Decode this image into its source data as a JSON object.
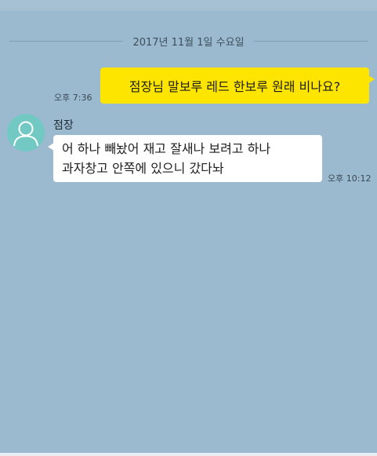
{
  "chat": {
    "date_separator": "2017년 11월 1일 수요일",
    "messages": [
      {
        "direction": "outgoing",
        "text": "점장님 말보루 레드 한보루 원래 비나요?",
        "time": "오후 7:36"
      },
      {
        "direction": "incoming",
        "sender": "점장",
        "lines": [
          "어 하나 빼놨어 재고 잘새나 보려고 하나",
          "과자창고 안쪽에 있으니 갔다놔"
        ],
        "time": "오후 10:12"
      }
    ]
  },
  "colors": {
    "background": "#9bb9cf",
    "outgoing_bubble": "#fee500",
    "incoming_bubble": "#ffffff",
    "avatar": "#72c9c3"
  },
  "icons": {
    "avatar": "default-profile-person-icon"
  }
}
